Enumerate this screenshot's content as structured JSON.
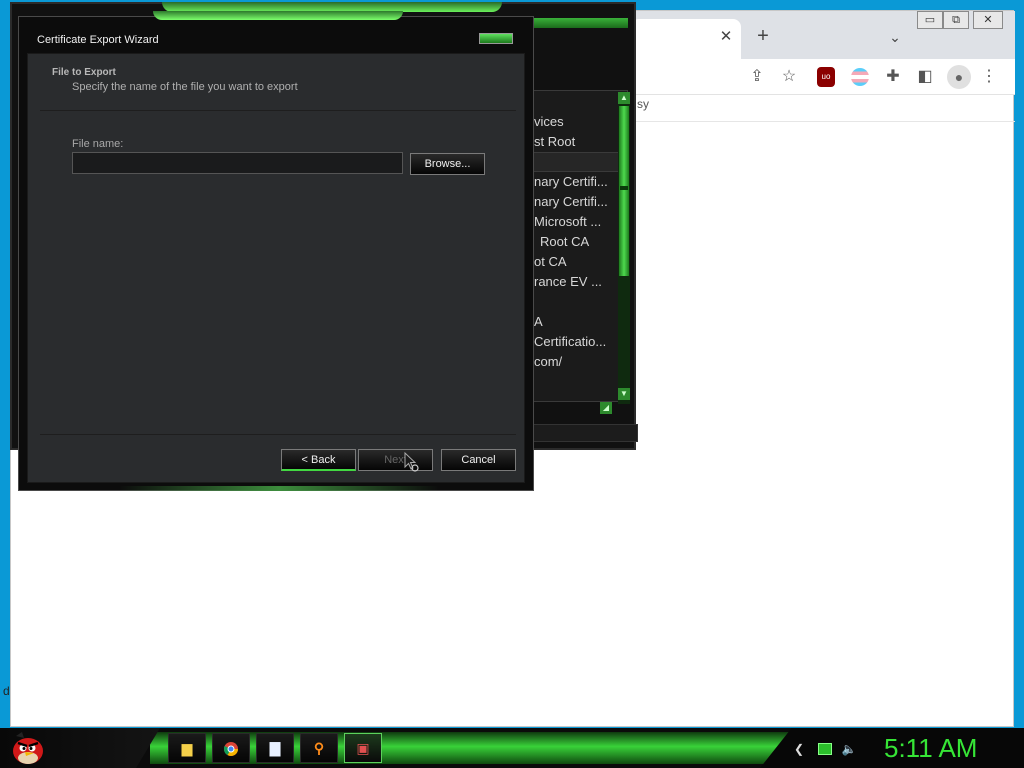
{
  "browser": {
    "tab_close": "✕",
    "new_tab": "+",
    "tab_menu": "⌄",
    "window_controls": [
      "▭",
      "⧉",
      "✕"
    ],
    "toolbar_icons": [
      "share-icon",
      "star-icon",
      "ublock-icon",
      "trans-flag-extension-icon",
      "puzzle-extensions-icon",
      "sidepanel-icon",
      "profile-icon",
      "more-menu-icon"
    ],
    "ublock_label": "uo",
    "bookmark_fragment": "sy",
    "left_fragment": "d"
  },
  "cert_manager": {
    "list_rows": [
      "vices",
      "st Root",
      "nary Certifi...",
      "nary Certifi...",
      "Microsoft ...",
      "Root CA",
      "ot CA",
      "rance EV ...",
      "",
      "A",
      "Certificatio...",
      "com/"
    ]
  },
  "wizard": {
    "title": "Certificate Export Wizard",
    "header_title": "File to Export",
    "header_desc": "Specify the name of the file you want to export",
    "file_name_label": "File name:",
    "file_name_value": "",
    "browse_label": "Browse...",
    "back_label": "< Back",
    "next_label": "Next",
    "cancel_label": "Cancel"
  },
  "taskbar": {
    "apps": [
      "file-explorer-icon",
      "chrome-icon",
      "notepad-icon",
      "search-icon",
      "cert-manager-icon"
    ],
    "clock": "5:11 AM"
  },
  "colors": {
    "desktop": "#0a99d6",
    "accent_green": "#36e536",
    "dialog_body": "#2a2c2e"
  }
}
